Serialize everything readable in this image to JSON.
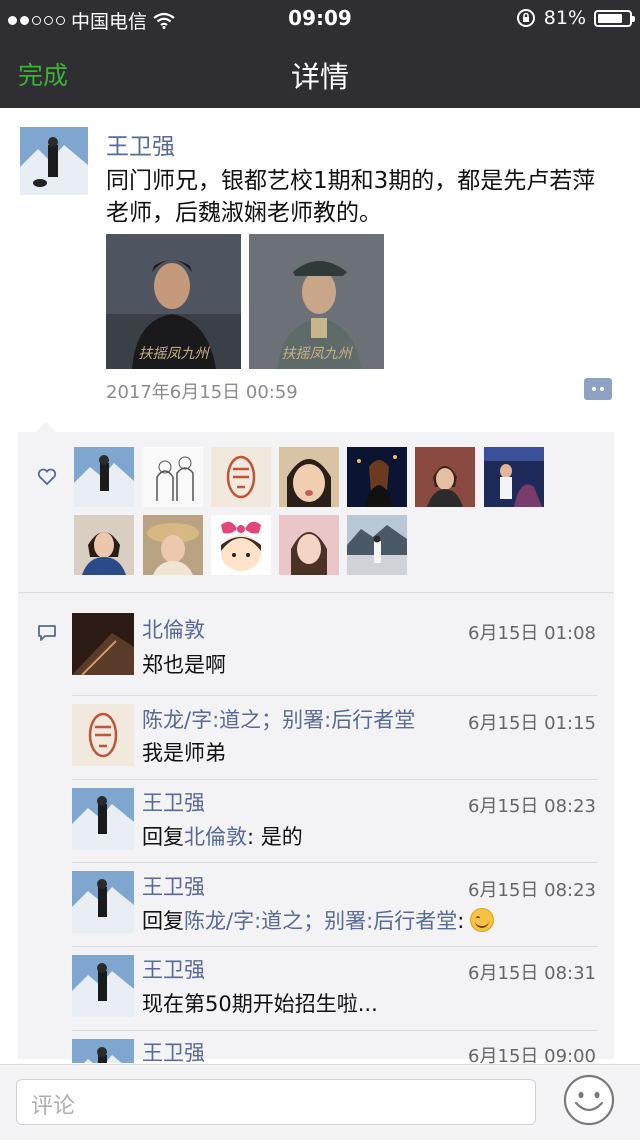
{
  "status_bar": {
    "carrier": "中国电信",
    "time": "09:09",
    "battery": "81%",
    "battery_level": 0.81
  },
  "nav": {
    "done_label": "完成",
    "title": "详情"
  },
  "post": {
    "author": "王卫强",
    "text": "同门师兄，银都艺校1期和3期的，都是先卢若萍老师，后魏淑娴老师教的。",
    "photos": [
      {
        "caption": "扶摇凤九州"
      },
      {
        "caption": "扶摇凤九州"
      }
    ],
    "time": "2017年6月15日 00:59"
  },
  "likes": {
    "icon": "heart-icon",
    "count": 12
  },
  "comments": [
    {
      "name": "北倫敦",
      "time": "6月15日 01:08",
      "text": "郑也是啊"
    },
    {
      "name": "陈龙/字:道之；别署:后行者堂",
      "time": "6月15日 01:15",
      "text": "我是师弟"
    },
    {
      "name": "王卫强",
      "time": "6月15日 08:23",
      "reply_prefix": "回复",
      "reply_to": "北倫敦",
      "text": ": 是的"
    },
    {
      "name": "王卫强",
      "time": "6月15日 08:23",
      "reply_prefix": "回复",
      "reply_to": "陈龙/字:道之；别署:后行者堂",
      "text": ":",
      "emoji": "smile-emoji"
    },
    {
      "name": "王卫强",
      "time": "6月15日 08:31",
      "text": "现在第50期开始招生啦..."
    },
    {
      "name": "王卫强",
      "time": "6月15日 09:00",
      "text": ""
    }
  ],
  "comment_bar": {
    "placeholder": "评论"
  },
  "colors": {
    "accent_green": "#3cb034",
    "name_blue": "#586a95",
    "nav_bg": "#2f2f33"
  }
}
